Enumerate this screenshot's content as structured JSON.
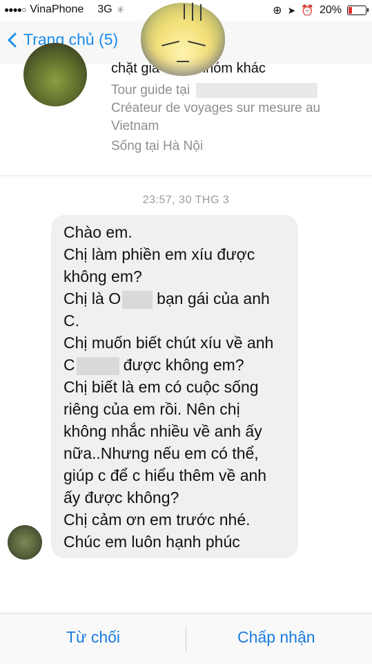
{
  "status_bar": {
    "carrier": "VinaPhone",
    "network": "3G",
    "battery": "20%",
    "signal_dots": "●●●●○"
  },
  "nav": {
    "back_label": "Trang chủ (5)"
  },
  "profile": {
    "line_partial": "chặt gia",
    "line_partial2": "nhóm khác",
    "tour_guide": "Tour guide tại",
    "creator_line1": "Créateur de voyages sur mesure au",
    "creator_line2": "Vietnam",
    "lives_in": "Sống tại Hà Nội"
  },
  "timestamp": "23:57, 30 THG 3",
  "message": {
    "l1": "Chào em.",
    "l2": "Chị làm phiền em xíu được",
    "l3": "không em?",
    "l4a": "Chị là O",
    "l4b": "bạn gái của anh",
    "l5": "C.",
    "l6": "Chị muốn biết chút xíu về anh",
    "l7a": "C",
    "l7b": "được không em?",
    "l8": "Chị biết là em có cuộc sống",
    "l9": "riêng của em rồi. Nên chị",
    "l10": "không nhắc nhiều về anh ấy",
    "l11": "nữa..Nhưng nếu em có thể,",
    "l12": "giúp c để c hiểu thêm về anh",
    "l13": "ấy được không?",
    "l14": "Chị cảm ơn em trước nhé.",
    "l15": "Chúc em luôn hạnh phúc"
  },
  "footer": {
    "decline": "Từ chối",
    "accept": "Chấp nhận"
  },
  "colors": {
    "accent": "#1a8cf0",
    "bubble": "#f0f0f2",
    "battery_low": "#e0322f"
  }
}
